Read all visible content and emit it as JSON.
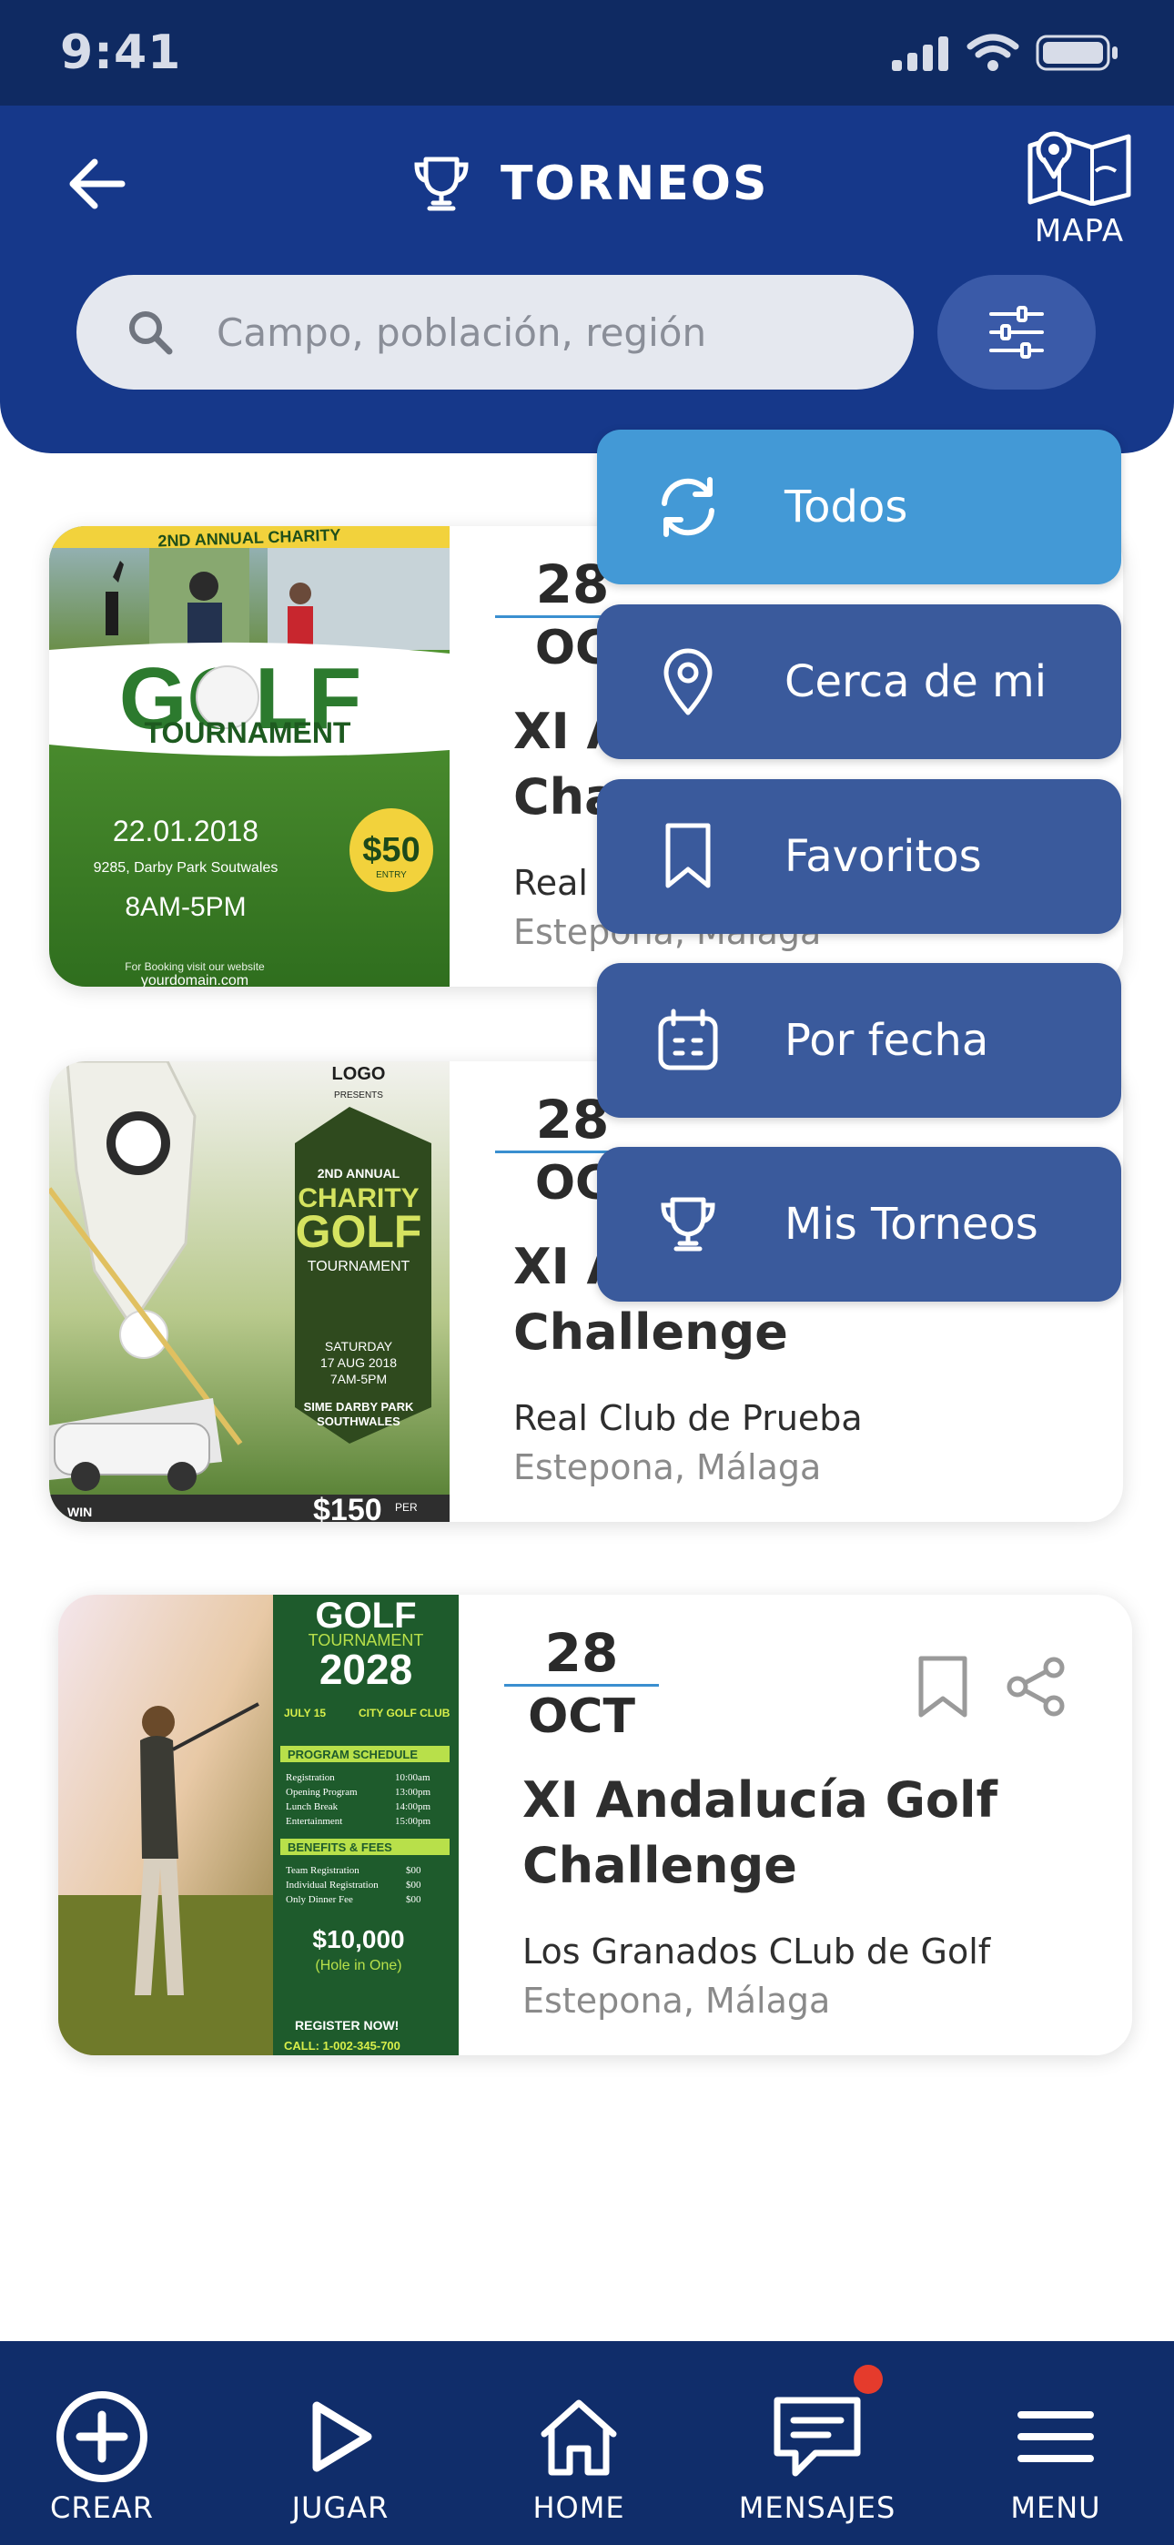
{
  "status_bar": {
    "time": "9:41"
  },
  "header": {
    "title": "TORNEOS",
    "map_label": "MAPA",
    "search_placeholder": "Campo, población, región"
  },
  "tournaments": [
    {
      "day": "28",
      "month": "OC",
      "title_line1": "XI A",
      "title_line2": "Cha",
      "club": "Real",
      "location": "Estepona, Málaga",
      "poster": {
        "banner": "2ND ANNUAL CHARITY",
        "headline": "GOLF",
        "sub": "TOURNAMENT",
        "date": "22.01.2018",
        "address": "9285, Darby Park Soutwales",
        "time": "8AM-5PM",
        "price": "$50",
        "price_note": "ENTRY",
        "footer": "For Booking visit our website",
        "url": "yourdomain.com"
      }
    },
    {
      "day": "28",
      "month": "OC",
      "title_line1": "XI A",
      "title_line2": "Challenge",
      "club": "Real Club de Prueba",
      "location": "Estepona, Málaga",
      "poster": {
        "logo": "LOGO",
        "presents": "PRESENTS",
        "annual": "2ND ANNUAL",
        "charity": "CHARITY",
        "headline": "GOLF",
        "sub": "TOURNAMENT",
        "day_line": "SATURDAY",
        "date": "17 AUG 2018",
        "time": "7AM-5PM",
        "venue_1": "SIME DARBY PARK",
        "venue_2": "SOUTHWALES",
        "win": "WIN",
        "price": "$150",
        "price_note": "PER"
      }
    },
    {
      "day": "28",
      "month": "OCT",
      "title_line1": "XI Andalucía Golf",
      "title_line2": "Challenge",
      "club": "Los Granados CLub de Golf",
      "location": "Estepona, Málaga",
      "poster": {
        "headline": "GOLF",
        "sub": "TOURNAMENT",
        "year": "2028",
        "when": "JULY 15",
        "venue": "CITY GOLF CLUB",
        "schedule_title": "PROGRAM SCHEDULE",
        "schedule": [
          [
            "Registration",
            "10:00am"
          ],
          [
            "Opening Program",
            "13:00pm"
          ],
          [
            "Lunch Break",
            "14:00pm"
          ],
          [
            "Entertainment",
            "15:00pm"
          ]
        ],
        "fees_title": "BENEFITS & FEES",
        "fees": [
          [
            "Team Registration",
            "$00"
          ],
          [
            "Individual Registration",
            "$00"
          ],
          [
            "Only Dinner Fee",
            "$00"
          ]
        ],
        "prize": "$10,000",
        "prize_note": "(Hole in One)",
        "cta": "REGISTER NOW!",
        "phone": "CALL: 1-002-345-700"
      }
    }
  ],
  "filter_menu": [
    {
      "label": "Todos",
      "icon": "refresh-icon",
      "active": true
    },
    {
      "label": "Cerca de mi",
      "icon": "location-pin-icon",
      "active": false
    },
    {
      "label": "Favoritos",
      "icon": "bookmark-icon",
      "active": false
    },
    {
      "label": "Por fecha",
      "icon": "calendar-icon",
      "active": false
    },
    {
      "label": "Mis Torneos",
      "icon": "trophy-icon",
      "active": false
    }
  ],
  "bottom_nav": [
    {
      "label": "CREAR",
      "icon": "plus-circle-icon"
    },
    {
      "label": "JUGAR",
      "icon": "play-icon"
    },
    {
      "label": "HOME",
      "icon": "home-icon"
    },
    {
      "label": "MENSAJES",
      "icon": "chat-icon",
      "has_badge": true
    },
    {
      "label": "MENU",
      "icon": "hamburger-icon"
    }
  ],
  "colors": {
    "header_bg": "#16388a",
    "status_bg": "#0f2a62",
    "menu_item": "#3a5a9c",
    "menu_active": "#4399d6",
    "nav_bg": "#102d6a",
    "badge": "#e53b2c"
  }
}
